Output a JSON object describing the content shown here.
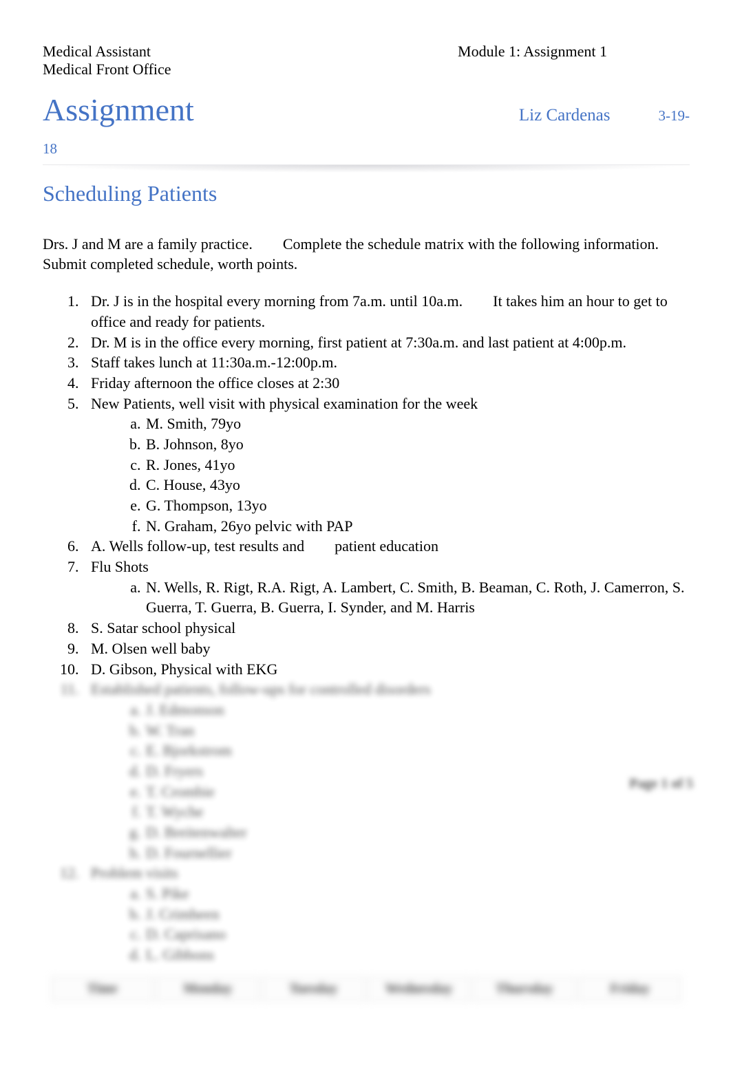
{
  "header": {
    "course": "Medical Assistant",
    "subcourse": "Medical Front Office",
    "module": "Module 1: Assignment 1"
  },
  "title": {
    "main": "Assignment",
    "student": "Liz Cardenas",
    "date_line1": "3-19-",
    "date_line2": "18"
  },
  "section_title": "Scheduling Patients",
  "intro": "Drs. J and M are a family practice.  Complete the schedule matrix with the following information. Submit completed schedule, worth points.",
  "items": {
    "i1": "Dr. J is in the hospital every morning from 7a.m. until 10a.m.  It takes him an hour to get to office and ready for patients.",
    "i2": "Dr. M is in the office every morning, first patient at 7:30a.m. and last patient at 4:00p.m.",
    "i3": "Staff takes lunch at 11:30a.m.-12:00p.m.",
    "i4": "Friday afternoon the office closes at 2:30",
    "i5": "New Patients, well visit with physical examination for the week",
    "i5a": "M. Smith, 79yo",
    "i5b": "B. Johnson, 8yo",
    "i5c": "R. Jones, 41yo",
    "i5d": "C. House, 43yo",
    "i5e": "G. Thompson, 13yo",
    "i5f": "N. Graham, 26yo pelvic with PAP",
    "i6": "A. Wells follow-up, test results and  patient education",
    "i7": "Flu Shots",
    "i7a": "N. Wells, R. Rigt, R.A. Rigt, A. Lambert, C. Smith, B. Beaman, C. Roth, J. Camerron, S. Guerra, T. Guerra, B. Guerra, I. Synder, and M. Harris",
    "i8": "S. Satar school physical",
    "i9": "M. Olsen well baby",
    "i10": "D. Gibson, Physical with EKG",
    "i11": "Established patients, follow-ups for controlled disorders",
    "i11a": "J. Edmonson",
    "i11b": "W. Tran",
    "i11c": "E. Bjorkstrom",
    "i11d": "D. Fryers",
    "i11e": "T. Crombie",
    "i11f": "T. Wyche",
    "i11g": "D. Breitenwalter",
    "i11h": "D. Fournellier",
    "i12": "Problem visits",
    "i12a": "S. Pike",
    "i12b": "J. Crimheen",
    "i12c": "D. Caprisano",
    "i12d": "L. Gibbons"
  },
  "table": {
    "h0": "Time",
    "h1": "Monday",
    "h2": "Tuesday",
    "h3": "Wednesday",
    "h4": "Thursday",
    "h5": "Friday"
  },
  "page_number": "Page 1 of 5"
}
